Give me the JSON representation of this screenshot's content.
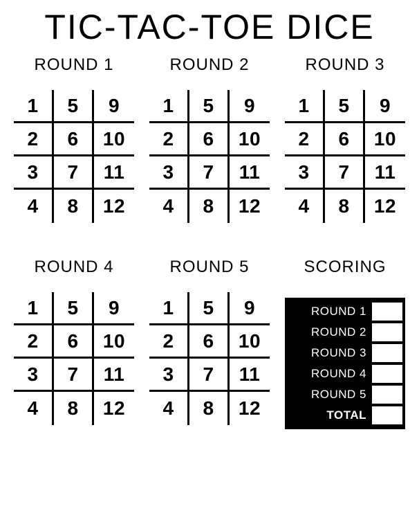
{
  "title": "TIC-TAC-TOE DICE",
  "round_labels": [
    "ROUND 1",
    "ROUND 2",
    "ROUND 3",
    "ROUND 4",
    "ROUND 5"
  ],
  "board_cells": [
    "1",
    "5",
    "9",
    "2",
    "6",
    "10",
    "3",
    "7",
    "11",
    "4",
    "8",
    "12"
  ],
  "scoring": {
    "heading": "SCORING",
    "rows": [
      "ROUND 1",
      "ROUND 2",
      "ROUND 3",
      "ROUND 4",
      "ROUND 5"
    ],
    "total": "TOTAL"
  }
}
